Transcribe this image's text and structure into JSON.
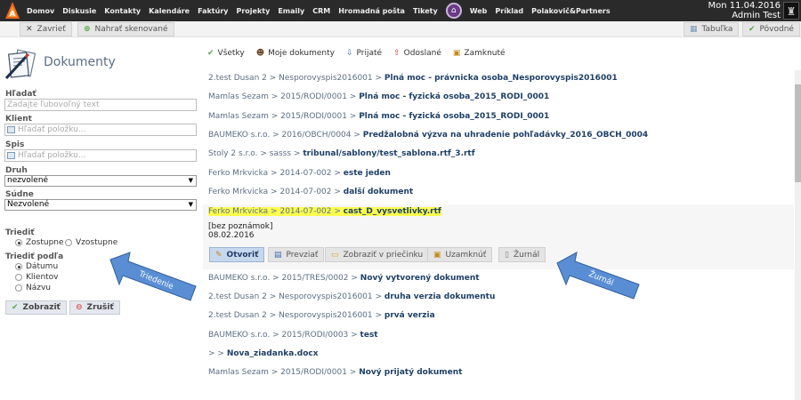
{
  "topbar": {
    "nav": [
      "Domov",
      "Diskusie",
      "Kontakty",
      "Kalendáre",
      "Faktúry",
      "Projekty",
      "Emaily",
      "CRM",
      "Hromadná pošta",
      "Tikety"
    ],
    "nav_after": [
      "Web",
      "Príklad",
      "Polakovič&Partners"
    ],
    "date": "Mon 11.04.2016",
    "user": "Admin Test"
  },
  "toolbar": {
    "close": "Zavrieť",
    "upload": "Nahrať skenované",
    "table": "Tabuľka",
    "original": "Pôvodné"
  },
  "sidebar": {
    "title": "Dokumenty",
    "search_label": "Hľadať",
    "search_placeholder": "Zadajte ľubovoľný text",
    "client_label": "Klient",
    "client_placeholder": "Hľadať položku...",
    "spis_label": "Spis",
    "spis_placeholder": "Hľadať položku...",
    "druh_label": "Druh",
    "druh_value": "nezvolené",
    "sudne_label": "Súdne",
    "sudne_value": "Nezvolené",
    "sort_label": "Triediť",
    "sort_asc": "Zostupne",
    "sort_desc": "Vzostupne",
    "sort_by_label": "Triediť podľa",
    "sort_by": [
      "Dátumu",
      "Klientov",
      "Názvu"
    ],
    "show_button": "Zobraziť",
    "cancel_button": "Zrušiť"
  },
  "filters": [
    "Všetky",
    "Moje dokumenty",
    "Prijaté",
    "Odoslané",
    "Zamknuté"
  ],
  "documents": [
    {
      "path": "2.test Dusan 2 > Nesporovyspis2016001 > ",
      "name": "Plná moc - právnicka osoba_Nesporovyspis2016001"
    },
    {
      "path": "Mamlas Sezam > 2015/RODI/0001 > ",
      "name": "Plná moc - fyzická osoba_2015_RODI_0001"
    },
    {
      "path": "Mamlas Sezam > 2015/RODI/0001 > ",
      "name": "Plná moc - fyzická osoba_2015_RODI_0001"
    },
    {
      "path": "BAUMEKO s.r.o. > 2016/OBCH/0004 > ",
      "name": "Predžalobná výzva na uhradenie pohľadávky_2016_OBCH_0004"
    },
    {
      "path": "Stoly 2 s.r.o. > sasss > ",
      "name": "tribunal/sablony/test_sablona.rtf_3.rtf"
    },
    {
      "path": "Ferko Mrkvicka > 2014-07-002 > ",
      "name": "este jeden"
    },
    {
      "path": "Ferko Mrkvicka > 2014-07-002 > ",
      "name": "další dokument"
    },
    {
      "path": "Ferko Mrkvicka > 2014-07-002 > ",
      "name": "cast_D_vysvetlivky.rtf"
    },
    {
      "path": "BAUMEKO s.r.o. > 2015/TRES/0002 > ",
      "name": "Nový vytvorený dokument"
    },
    {
      "path": "2.test Dusan 2 > Nesporovyspis2016001 > ",
      "name": "druha verzia dokumentu"
    },
    {
      "path": "2.test Dusan 2 > Nesporovyspis2016001 > ",
      "name": "prvá verzia"
    },
    {
      "path": "BAUMEKO s.r.o. > 2015/RODI/0003 > ",
      "name": "test"
    },
    {
      "path": "> > ",
      "name": "Nova_ziadanka.docx"
    },
    {
      "path": "Mamlas Sezam > 2015/RODI/0001 > ",
      "name": "Nový prijatý dokument"
    }
  ],
  "expanded": {
    "note": "[bez poznámok]",
    "date": "08.02.2016",
    "actions": [
      "Otvoriť",
      "Prevziať",
      "Zobraziť v priečinku",
      "Uzamknúť",
      "Žurnál"
    ]
  },
  "annotations": {
    "left_arrow": "Triedenie",
    "right_arrow": "Žurnál"
  }
}
